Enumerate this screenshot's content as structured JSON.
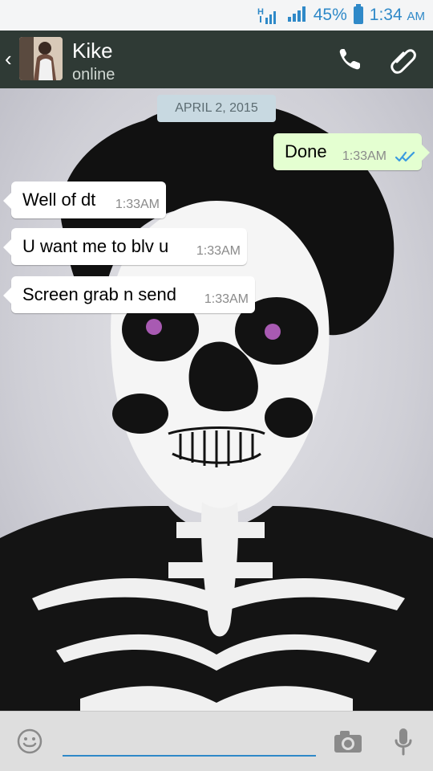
{
  "status_bar": {
    "network_label": "H",
    "battery_percent": "45%",
    "time": "1:34",
    "time_suffix": "AM"
  },
  "header": {
    "contact_name": "Kike",
    "presence": "online"
  },
  "chat": {
    "date_separator": "APRIL 2, 2015",
    "messages": [
      {
        "text": "Done",
        "time": "1:33AM",
        "direction": "outgoing"
      },
      {
        "text": "Well of dt",
        "time": "1:33AM",
        "direction": "incoming"
      },
      {
        "text": "U want me to blv u",
        "time": "1:33AM",
        "direction": "incoming"
      },
      {
        "text": "Screen grab n send",
        "time": "1:33AM",
        "direction": "incoming"
      }
    ]
  },
  "input_bar": {
    "placeholder": "",
    "icons": [
      "emoji-icon",
      "camera-icon",
      "mic-icon"
    ]
  },
  "colors": {
    "status_accent": "#2f89c8",
    "header_bg": "#2f3a35",
    "outgoing_bubble": "#e4ffd1",
    "incoming_bubble": "#ffffff",
    "read_ticks": "#3a9be0"
  }
}
